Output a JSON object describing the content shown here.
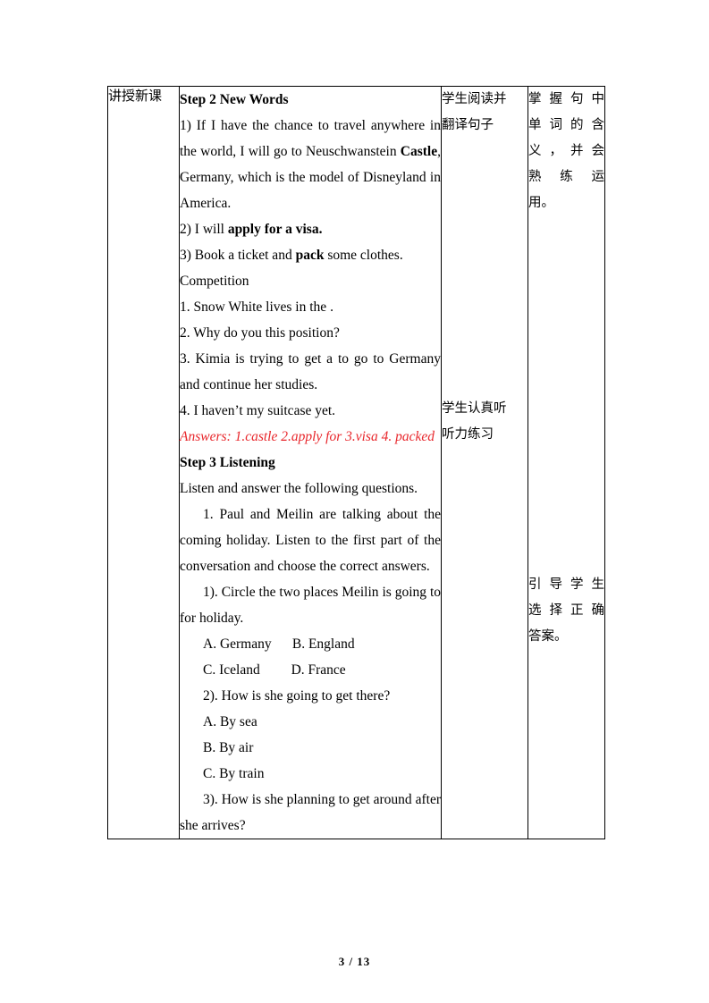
{
  "document": {
    "footer": "3  /  13"
  },
  "table": {
    "stage": {
      "label": "讲授新课"
    },
    "content": {
      "step2_heading": "Step 2 New Words",
      "item1_pre": "1) If I have the chance to travel anywhere in the world, I will go to Neuschwanstein ",
      "item1_bold": "Castle",
      "item1_post": ", Germany, which is the model of Disneyland in America.",
      "item2_pre": "2) I will ",
      "item2_bold": "apply for a visa.",
      "item3_pre": "3) Book a ticket and ",
      "item3_bold": "pack",
      "item3_post": " some clothes.",
      "competition_heading": "Competition",
      "q1_pre": "1. Snow White lives in the ",
      "q1_blank": "              ",
      "q1_post": ".",
      "q2_pre": "2. Why do you ",
      "q2_blank": "              ",
      "q2_post": "this position?",
      "q3_pre": "3. Kimia is trying to get a ",
      "q3_blank": "           ",
      "q3_post": "to go to Germany and continue her studies.",
      "q4_pre": "4. I haven’t ",
      "q4_blank": "            ",
      "q4_post": "my suitcase yet.",
      "answers": "Answers:  1.castle  2.apply for  3.visa  4. packed",
      "step3_heading": "Step 3 Listening",
      "listen_intro": "Listen and answer the following questions.",
      "task1": "1. Paul and Meilin are talking about the coming holiday. Listen to the first part of the conversation and choose the correct answers.",
      "sub1": "1). Circle the two places Meilin is going to for holiday.",
      "opt_ab": "A. Germany      B. England",
      "opt_cd": "C. Iceland         D. France",
      "sub2": "2). How is she going to get there?",
      "opt_a2": "A. By sea",
      "opt_b2": "B. By air",
      "opt_c2": "C. By train",
      "sub3": "3). How is she planning to get around after she arrives?"
    },
    "activity": {
      "line1": "学生阅读并",
      "line2": "翻译句子",
      "line3": "学生认真听",
      "line4": "听力练习"
    },
    "aim": {
      "line1": "掌握句中",
      "line2": "单词的含",
      "line3": "义，并会",
      "line4": "熟练运",
      "line5": "用。",
      "line6": "引导学生",
      "line7": "选择正确",
      "line8": "答案。"
    }
  }
}
